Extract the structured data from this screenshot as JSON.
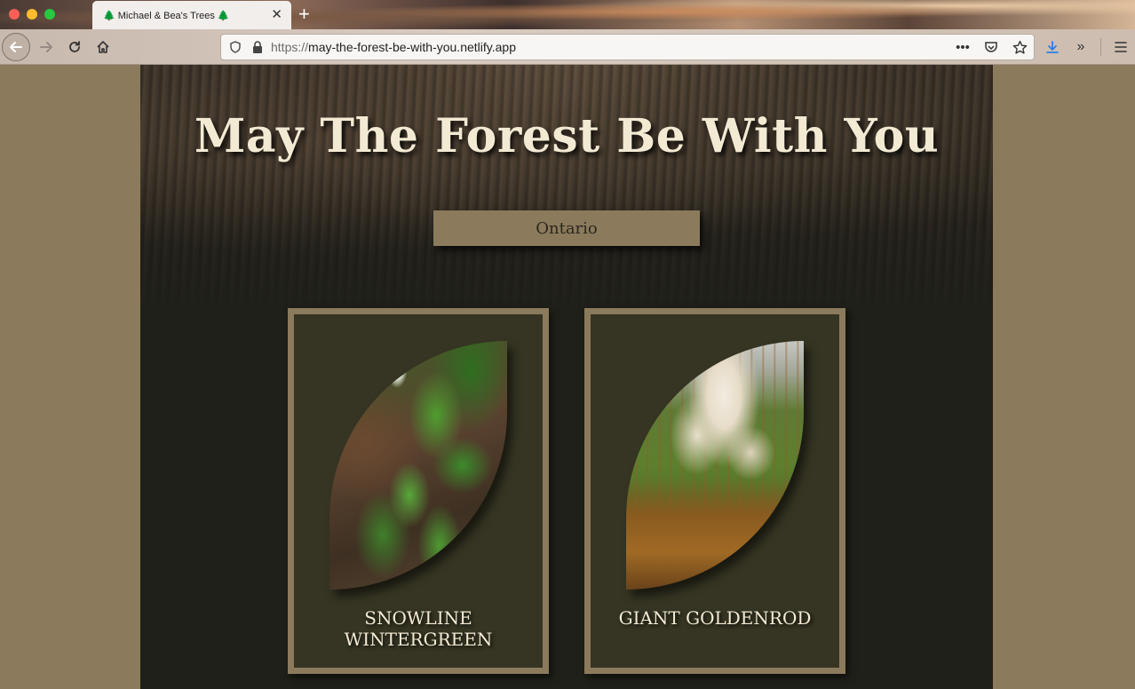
{
  "browser": {
    "tab_title": "🌲 Michael & Bea's Trees 🌲",
    "url_protocol": "https://",
    "url_host": "may-the-forest-be-with-you.netlify.app"
  },
  "page": {
    "title": "May The Forest Be With You",
    "region_button": "Ontario"
  },
  "cards": [
    {
      "label": "Snowline Wintergreen"
    },
    {
      "label": "Giant Goldenrod"
    }
  ],
  "colors": {
    "page_bg": "#8b7b5c",
    "content_bg": "#20201a",
    "card_bg": "#363523",
    "accent": "#8b7b5c",
    "title_text": "#f3ead4"
  }
}
